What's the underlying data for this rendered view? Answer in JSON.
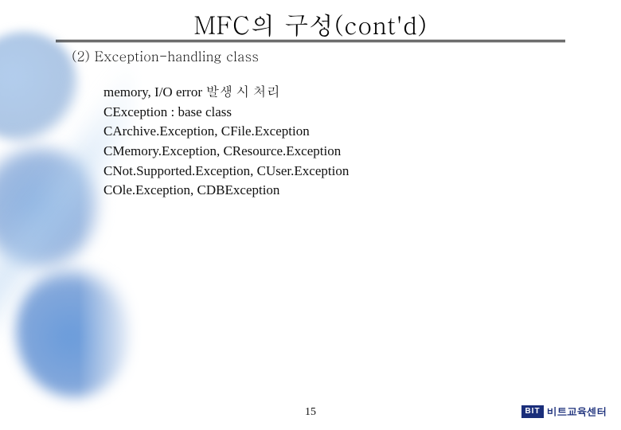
{
  "title": "MFC의 구성(cont'd)",
  "subtitle": "(2) Exception-handling class",
  "body": {
    "lines": [
      "memory, I/O error 발생 시 처리",
      "CException : base class",
      "CArchive.Exception, CFile.Exception",
      "CMemory.Exception, CResource.Exception",
      "CNot.Supported.Exception, CUser.Exception",
      "COle.Exception, CDBException"
    ]
  },
  "page_number": "15",
  "footer": {
    "logo_mark": "BIT",
    "logo_text": "비트교육센터"
  }
}
